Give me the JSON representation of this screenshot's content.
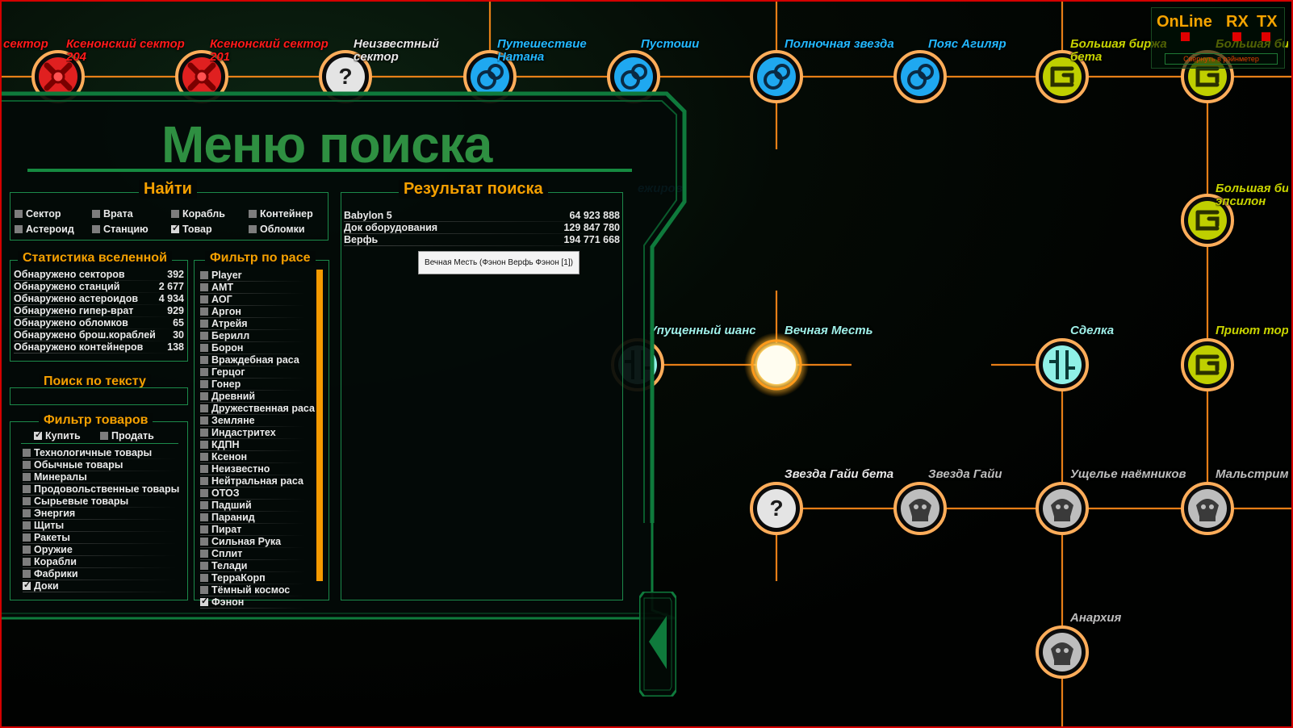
{
  "status": {
    "online": "OnLine",
    "rx": "RX",
    "tx": "TX",
    "collapse": "Свернуть в рэйнметер"
  },
  "panel": {
    "title": "Меню поиска",
    "find": {
      "title": "Найти",
      "options": [
        {
          "label": "Сектор",
          "checked": false
        },
        {
          "label": "Врата",
          "checked": false
        },
        {
          "label": "Корабль",
          "checked": false
        },
        {
          "label": "Контейнер",
          "checked": false
        },
        {
          "label": "Астероид",
          "checked": false
        },
        {
          "label": "Станцию",
          "checked": false
        },
        {
          "label": "Товар",
          "checked": true
        },
        {
          "label": "Обломки",
          "checked": false
        }
      ]
    },
    "stats": {
      "title": "Статистика вселенной",
      "rows": [
        {
          "label": "Обнаружено секторов",
          "value": "392"
        },
        {
          "label": "Обнаружено станций",
          "value": "2 677"
        },
        {
          "label": "Обнаружено астероидов",
          "value": "4 934"
        },
        {
          "label": "Обнаружено гипер-врат",
          "value": "929"
        },
        {
          "label": "Обнаружено обломков",
          "value": "65"
        },
        {
          "label": "Обнаружено брош.кораблей",
          "value": "30"
        },
        {
          "label": "Обнаружено контейнеров",
          "value": "138"
        }
      ]
    },
    "text_search": {
      "title": "Поиск по тексту",
      "value": ""
    },
    "goods_filter": {
      "title": "Фильтр товаров",
      "buy": "Купить",
      "buy_checked": true,
      "sell": "Продать",
      "sell_checked": false,
      "items": [
        {
          "label": "Технологичные товары",
          "checked": false
        },
        {
          "label": "Обычные товары",
          "checked": false
        },
        {
          "label": "Минералы",
          "checked": false
        },
        {
          "label": "Продовольственные товары",
          "checked": false
        },
        {
          "label": "Сырьевые товары",
          "checked": false
        },
        {
          "label": "Энергия",
          "checked": false
        },
        {
          "label": "Щиты",
          "checked": false
        },
        {
          "label": "Ракеты",
          "checked": false
        },
        {
          "label": "Оружие",
          "checked": false
        },
        {
          "label": "Корабли",
          "checked": false
        },
        {
          "label": "Фабрики",
          "checked": false
        },
        {
          "label": "Доки",
          "checked": true
        }
      ]
    },
    "race_filter": {
      "title": "Фильтр по расе",
      "items": [
        {
          "label": "Player",
          "checked": false
        },
        {
          "label": "АМТ",
          "checked": false
        },
        {
          "label": "АОГ",
          "checked": false
        },
        {
          "label": "Аргон",
          "checked": false
        },
        {
          "label": "Атрейя",
          "checked": false
        },
        {
          "label": "Берилл",
          "checked": false
        },
        {
          "label": "Борон",
          "checked": false
        },
        {
          "label": "Враждебная раса",
          "checked": false
        },
        {
          "label": "Герцог",
          "checked": false
        },
        {
          "label": "Гонер",
          "checked": false
        },
        {
          "label": "Древний",
          "checked": false
        },
        {
          "label": "Дружественная раса",
          "checked": false
        },
        {
          "label": "Земляне",
          "checked": false
        },
        {
          "label": "Индастритех",
          "checked": false
        },
        {
          "label": "КДПН",
          "checked": false
        },
        {
          "label": "Ксенон",
          "checked": false
        },
        {
          "label": "Неизвестно",
          "checked": false
        },
        {
          "label": "Нейтральная раса",
          "checked": false
        },
        {
          "label": "ОТОЗ",
          "checked": false
        },
        {
          "label": "Падший",
          "checked": false
        },
        {
          "label": "Паранид",
          "checked": false
        },
        {
          "label": "Пират",
          "checked": false
        },
        {
          "label": "Сильная Рука",
          "checked": false
        },
        {
          "label": "Сплит",
          "checked": false
        },
        {
          "label": "Телади",
          "checked": false
        },
        {
          "label": "ТерраКорп",
          "checked": false
        },
        {
          "label": "Тёмный космос",
          "checked": false
        },
        {
          "label": "Фэнон",
          "checked": true
        }
      ]
    },
    "results": {
      "title": "Результат поиска",
      "rows": [
        {
          "name": "Babylon 5",
          "value": "64 923 888"
        },
        {
          "name": "Док оборудования",
          "value": "129 847 780"
        },
        {
          "name": "Верфь",
          "value": "194 771 668"
        }
      ],
      "tooltip": "Вечная Месть (Фэнон Верфь Фэнон [1])"
    }
  },
  "map": {
    "nodes": [
      {
        "label": "сектор",
        "icon": "xenon-icon",
        "color": "#ff1a1a"
      },
      {
        "label": "Ксенонский сектор\n204",
        "icon": "xenon-icon",
        "color": "#ff1a1a"
      },
      {
        "label": "Ксенонский сектор\n201",
        "icon": "xenon-icon",
        "color": "#ff1a1a"
      },
      {
        "label": "Неизвестный\nсектор",
        "icon": "unknown-icon",
        "color": "#e8e8e8"
      },
      {
        "label": "Путешествие\nНатана",
        "icon": "boron-icon",
        "color": "#22b8ff"
      },
      {
        "label": "Пустоши",
        "icon": "boron-icon",
        "color": "#22b8ff"
      },
      {
        "label": "Полночная звезда",
        "icon": "boron-icon",
        "color": "#22b8ff"
      },
      {
        "label": "Пояс Агиляр",
        "icon": "boron-icon",
        "color": "#22b8ff"
      },
      {
        "label": "Большая биржа\nбета",
        "icon": "teladi-icon",
        "color": "#c8d400"
      },
      {
        "label": "Большая биржа",
        "icon": "teladi-icon",
        "color": "#c8d400"
      },
      {
        "label": "Большая биржа\nэпсилон",
        "icon": "teladi-icon",
        "color": "#c8d400"
      },
      {
        "label": "ежиров",
        "icon": "",
        "color": "#22b8ff"
      },
      {
        "label": "Упущенный шанс",
        "icon": "split-icon",
        "color": "#9ff0e8"
      },
      {
        "label": "Вечная Месть",
        "icon": "glow-icon",
        "color": "#9ff0e8"
      },
      {
        "label": "Сделка",
        "icon": "split-icon",
        "color": "#9ff0e8"
      },
      {
        "label": "Приют торговца",
        "icon": "teladi-icon",
        "color": "#c8d400"
      },
      {
        "label": "Звезда Гайи бета",
        "icon": "unknown-icon",
        "color": "#e8e8e8"
      },
      {
        "label": "Звезда Гайи",
        "icon": "pirate-icon",
        "color": "#bdbdbd"
      },
      {
        "label": "Ущелье наёмников",
        "icon": "pirate-icon",
        "color": "#bdbdbd"
      },
      {
        "label": "Мальстрим",
        "icon": "pirate-icon",
        "color": "#bdbdbd"
      },
      {
        "label": "Анархия",
        "icon": "pirate-icon",
        "color": "#bdbdbd"
      }
    ]
  }
}
